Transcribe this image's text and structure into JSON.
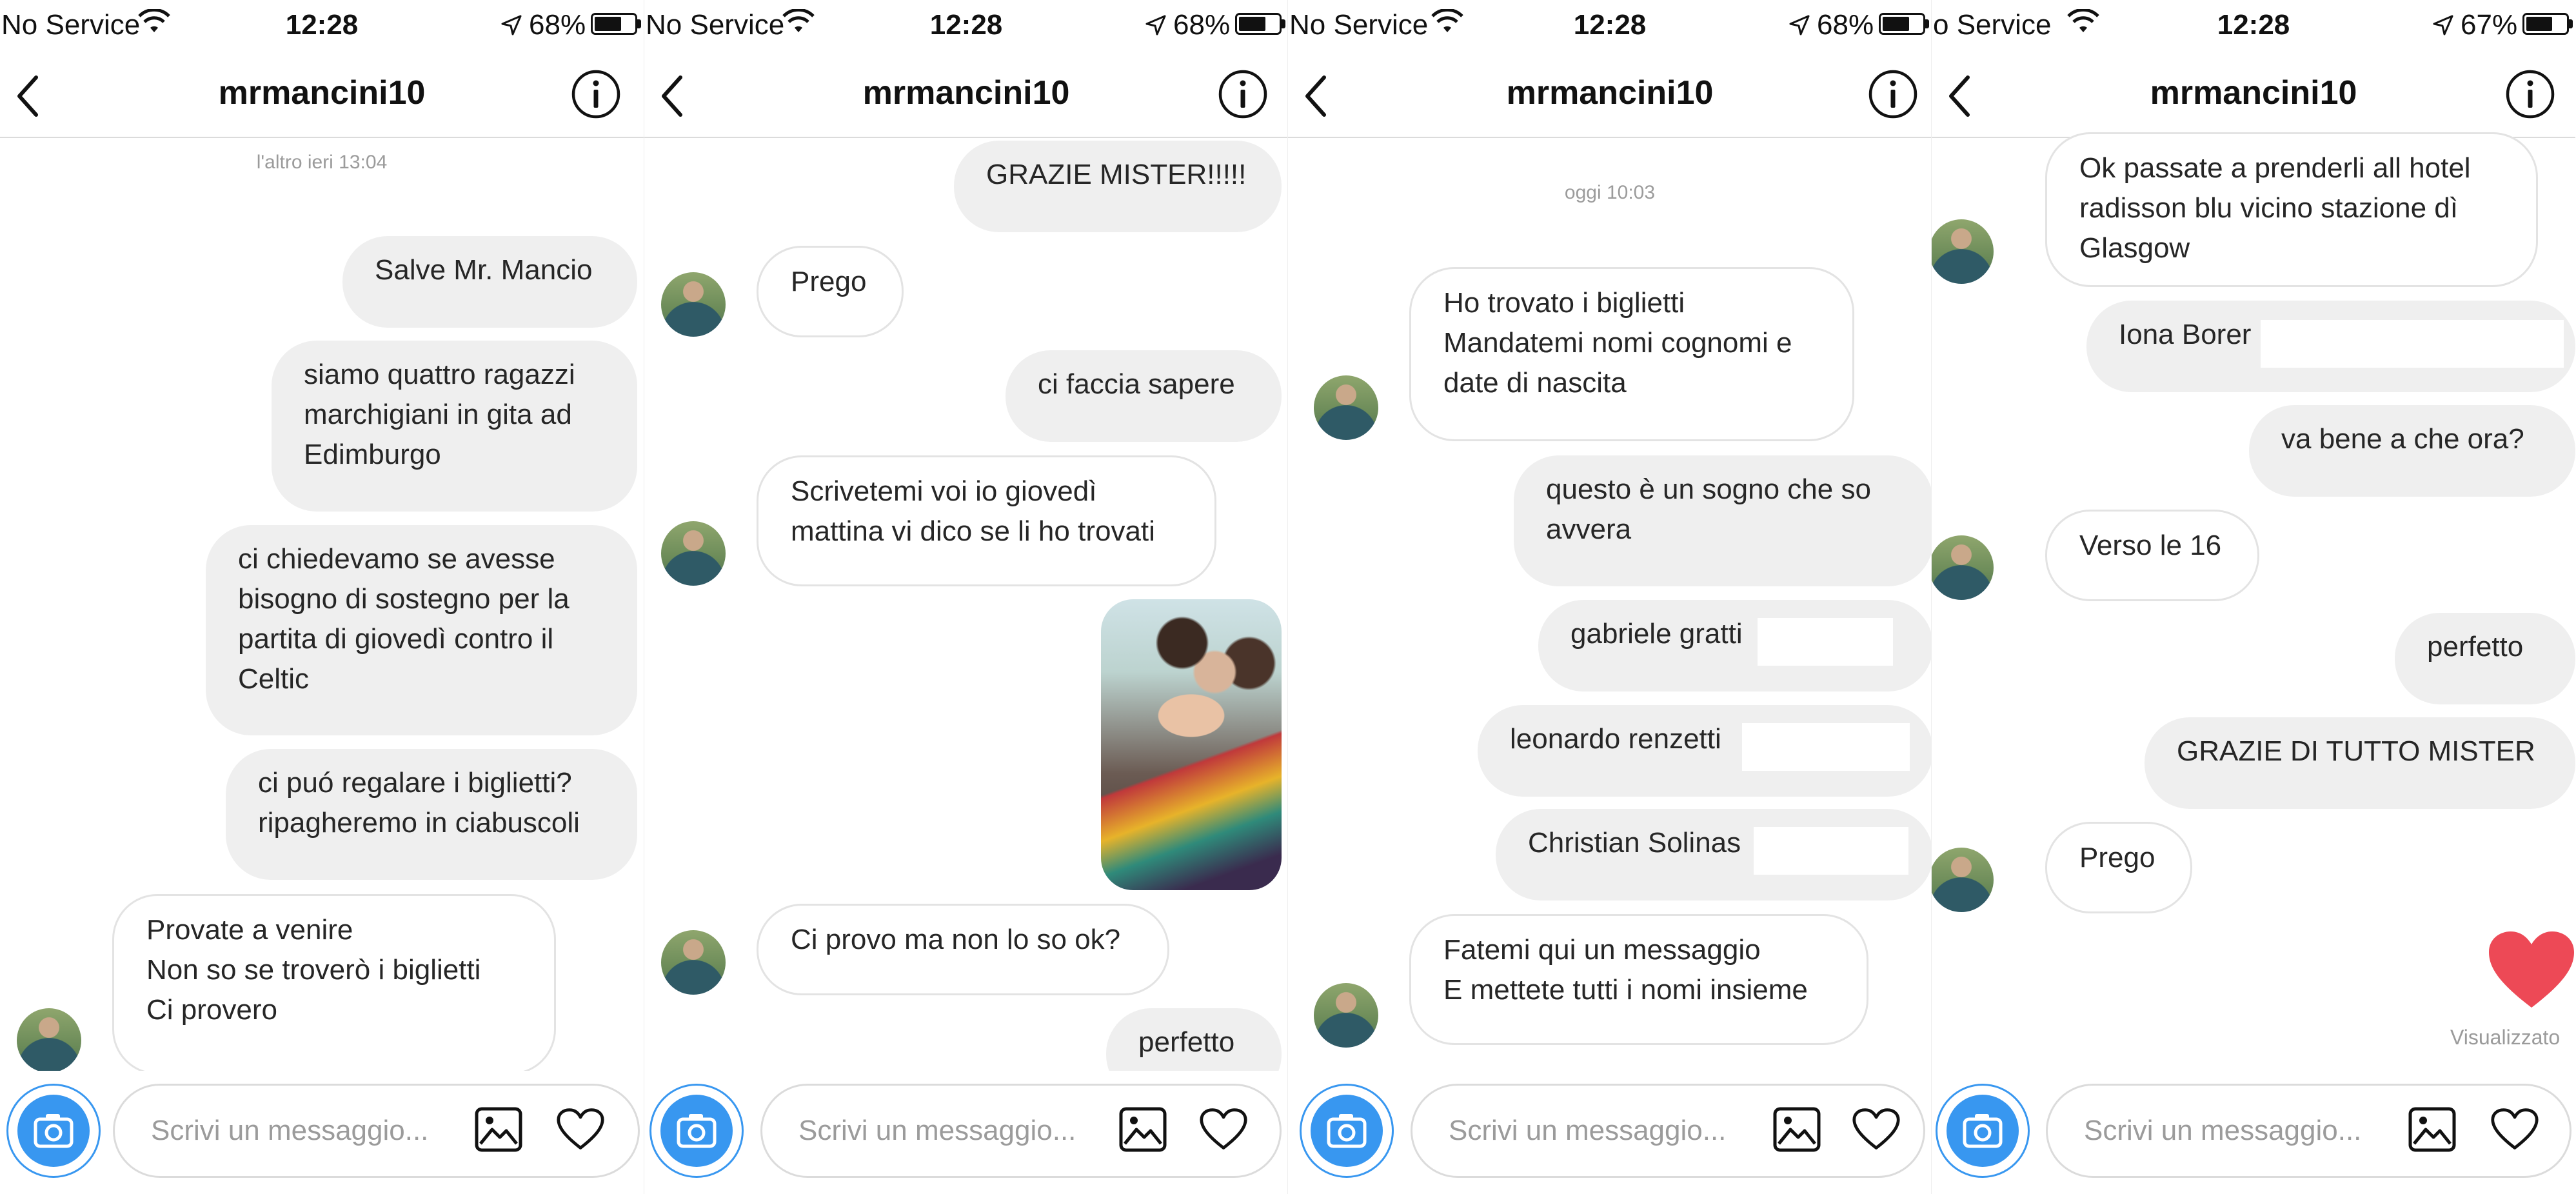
{
  "status_bar": [
    {
      "carrier": "No Service",
      "time": "12:28",
      "battery": "68%",
      "battery_level": 0.68
    },
    {
      "carrier": "No Service",
      "time": "12:28",
      "battery": "68%",
      "battery_level": 0.68
    },
    {
      "carrier": "No Service",
      "time": "12:28",
      "battery": "68%",
      "battery_level": 0.68
    },
    {
      "carrier": "o Service",
      "time": "12:28",
      "battery": "67%",
      "battery_level": 0.67
    }
  ],
  "header": {
    "title": "mrmancini10"
  },
  "composer": {
    "placeholder": "Scrivi un messaggio..."
  },
  "colors": {
    "accent": "#3897f0",
    "bubble_out": "#efefef",
    "heart": "#ed4956"
  },
  "icons": [
    "back-icon",
    "info-icon",
    "camera-icon",
    "gallery-icon",
    "heart-icon",
    "wifi-icon",
    "location-arrow-icon",
    "battery-icon"
  ],
  "panels": [
    {
      "timestamp": "l'altro ieri 13:04",
      "messages": [
        {
          "lines": [
            "Salve Mr. Mancio"
          ]
        },
        {
          "lines": [
            "siamo quattro ragazzi",
            "marchigiani in gita ad",
            "Edimburgo"
          ]
        },
        {
          "lines": [
            "ci chiedevamo se avesse",
            "bisogno di sostegno per la",
            "partita di giovedì contro il",
            "Celtic"
          ]
        },
        {
          "lines": [
            "ci puó regalare i biglietti?",
            "ripagheremo in ciabuscoli"
          ]
        },
        {
          "lines": [
            "Provate a venire",
            "Non so se troverò i biglietti",
            "Ci provero"
          ]
        }
      ]
    },
    {
      "messages": [
        {
          "lines": [
            "GRAZIE MISTER!!!!!"
          ]
        },
        {
          "lines": [
            "Prego"
          ]
        },
        {
          "lines": [
            "ci faccia sapere"
          ]
        },
        {
          "lines": [
            "Scrivetemi voi io giovedì",
            "mattina vi dico se li ho trovati"
          ]
        },
        {
          "lines": [
            "Ci provo ma non lo so ok?"
          ]
        },
        {
          "lines": [
            "perfetto"
          ]
        }
      ]
    },
    {
      "timestamp": "oggi 10:03",
      "messages": [
        {
          "lines": [
            "Ho trovato i biglietti",
            "Mandatemi nomi cognomi e",
            "date di nascita"
          ]
        },
        {
          "lines": [
            "questo è un sogno che so",
            "avvera"
          ]
        },
        {
          "lines": [
            "gabriele gratti"
          ]
        },
        {
          "lines": [
            "leonardo renzetti"
          ]
        },
        {
          "lines": [
            "Christian Solinas"
          ]
        },
        {
          "lines": [
            "Fatemi qui un messaggio",
            "E mettete tutti i nomi insieme"
          ]
        }
      ]
    },
    {
      "seen_label": "Visualizzato",
      "messages": [
        {
          "lines": [
            "Ok passate a prenderli all hotel",
            "radisson blu vicino stazione dì",
            "Glasgow"
          ]
        },
        {
          "lines": [
            "Iona Borer"
          ]
        },
        {
          "lines": [
            "va bene a che ora?"
          ]
        },
        {
          "lines": [
            "Verso le 16"
          ]
        },
        {
          "lines": [
            "perfetto"
          ]
        },
        {
          "lines": [
            "GRAZIE DI TUTTO MISTER"
          ]
        },
        {
          "lines": [
            "Prego"
          ]
        }
      ]
    }
  ]
}
